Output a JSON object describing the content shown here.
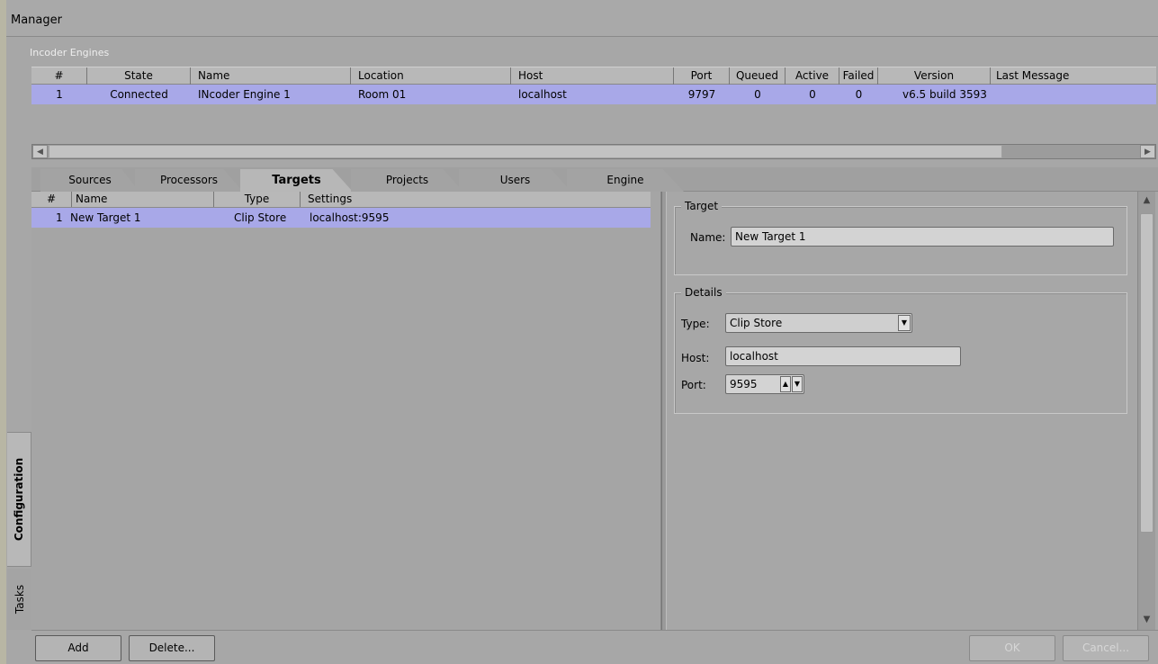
{
  "window": {
    "title": "Manager"
  },
  "engines": {
    "section_label": "Incoder Engines",
    "columns": [
      "#",
      "State",
      "Name",
      "Location",
      "Host",
      "Port",
      "Queued",
      "Active",
      "Failed",
      "Version",
      "Last Message"
    ],
    "rows": [
      {
        "num": "1",
        "state": "Connected",
        "name": "INcoder Engine 1",
        "location": "Room 01",
        "host": "localhost",
        "port": "9797",
        "queued": "0",
        "active": "0",
        "failed": "0",
        "version": "v6.5 build 3593",
        "last_message": ""
      }
    ]
  },
  "tabs": {
    "items": [
      "Sources",
      "Processors",
      "Targets",
      "Projects",
      "Users",
      "Engine"
    ],
    "active": "Targets"
  },
  "targets": {
    "columns": [
      "#",
      "Name",
      "Type",
      "Settings"
    ],
    "rows": [
      {
        "num": "1",
        "name": "New Target 1",
        "type": "Clip Store",
        "settings": "localhost:9595"
      }
    ]
  },
  "target_group": {
    "legend": "Target",
    "name_label": "Name:",
    "name_value": "New Target 1"
  },
  "details_group": {
    "legend": "Details",
    "type_label": "Type:",
    "type_value": "Clip Store",
    "host_label": "Host:",
    "host_value": "localhost",
    "port_label": "Port:",
    "port_value": "9595"
  },
  "side_tabs": [
    "Configuration",
    "Tasks"
  ],
  "buttons": {
    "add": "Add",
    "delete": "Delete...",
    "ok": "OK",
    "cancel": "Cancel..."
  },
  "icons": {
    "scroll_left": "arrow-left-icon",
    "scroll_right": "arrow-right-icon",
    "scroll_up": "arrow-up-icon",
    "scroll_down": "arrow-down-icon",
    "dropdown": "chevron-down-icon",
    "spin_up": "spin-up-icon",
    "spin_down": "spin-down-icon"
  },
  "colors": {
    "selection": "#a8a8e8",
    "background": "#a7a7a7"
  }
}
